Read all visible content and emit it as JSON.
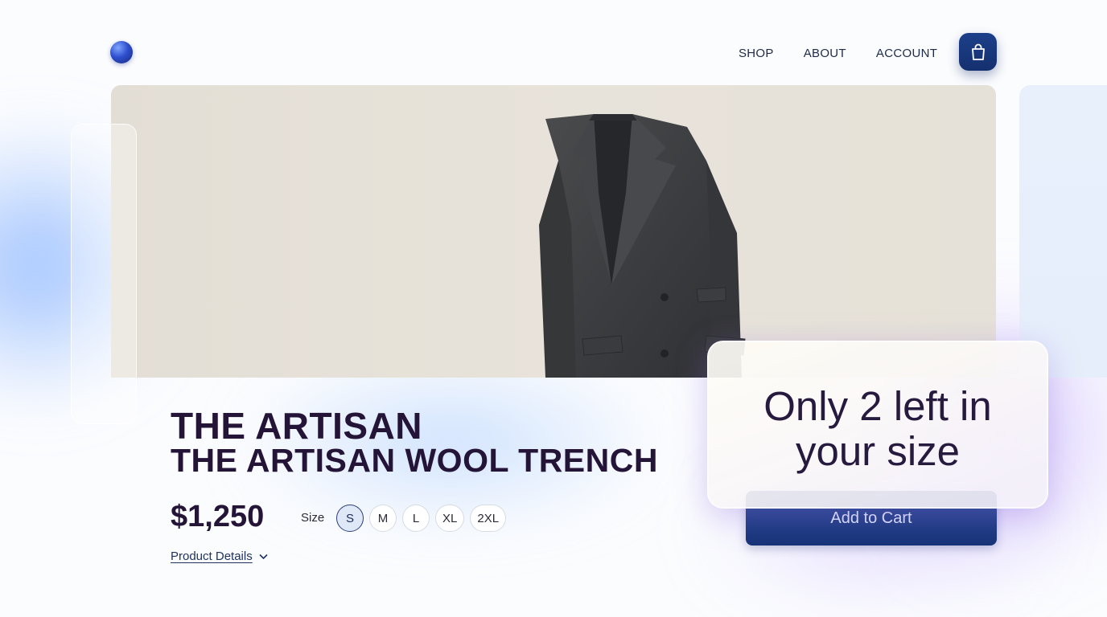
{
  "nav": {
    "items": [
      "SHOP",
      "ABOUT",
      "ACCOUNT"
    ],
    "cart_icon": "shopping-bag-icon",
    "logo_icon": "sphere-logo"
  },
  "hero": {
    "image": "charcoal wool jacket"
  },
  "product": {
    "title_line1": "THE ARTISAN",
    "title_line2": "THE ARTISAN WOOL TRENCH",
    "price": "$1,250",
    "size_label": "Size",
    "sizes": [
      "S",
      "M",
      "L",
      "XL",
      "2XL"
    ],
    "selected_size": "S",
    "details_label": "Product Details",
    "details_icon": "chevron-down-icon"
  },
  "cta": {
    "add_to_cart": "Add to Cart"
  },
  "popup": {
    "message": "Only 2 left in your size"
  },
  "colors": {
    "accent": "#1d3f8a",
    "title": "#241438",
    "hero_bg": "#e6e1d8"
  }
}
